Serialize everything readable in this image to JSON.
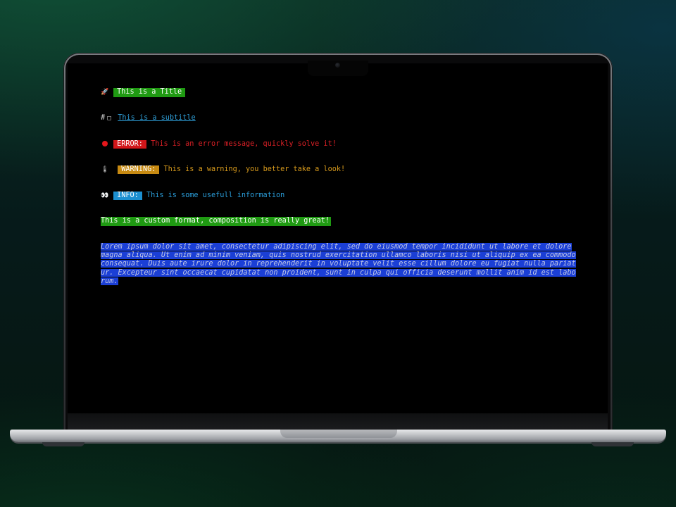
{
  "terminal": {
    "title": {
      "icon": "rocket-icon",
      "glyph": "🚀",
      "text": "This is a Title"
    },
    "subtitle": {
      "prefix": "#",
      "icon": "square-icon",
      "glyph": "□",
      "text": "This is a subtitle"
    },
    "error": {
      "icon": "red-circle-icon",
      "label": "ERROR:",
      "message": "This is an error message, quickly solve it!"
    },
    "warning": {
      "icon": "thermometer-icon",
      "glyph": "🌡",
      "label": "WARNING:",
      "message": "This is a warning, you better take a look!"
    },
    "info": {
      "icon": "eyes-icon",
      "glyph": "👀",
      "label": "INFO:",
      "message": "This is some usefull information"
    },
    "custom": {
      "text": "This is a custom format, composition is really great!"
    },
    "lorem": "Lorem ipsum dolor sit amet, consectetur adipiscing elit, sed do eiusmod tempor incididunt ut labore et dolore magna aliqua. Ut enim ad minim veniam, quis nostrud exercitation ullamco laboris nisi ut aliquip ex ea commodo consequat. Duis aute irure dolor in reprehenderit in voluptate velit esse cillum dolore eu fugiat nulla pariatur. Excepteur sint occaecat cupidatat non proident, sunt in culpa qui officia deserunt mollit anim id est laborum."
  },
  "colors": {
    "title_bg": "#1f9a12",
    "error": "#d2161a",
    "warning": "#c78a12",
    "info": "#1c8fd0",
    "lorem_bg": "#1b3fd6"
  }
}
